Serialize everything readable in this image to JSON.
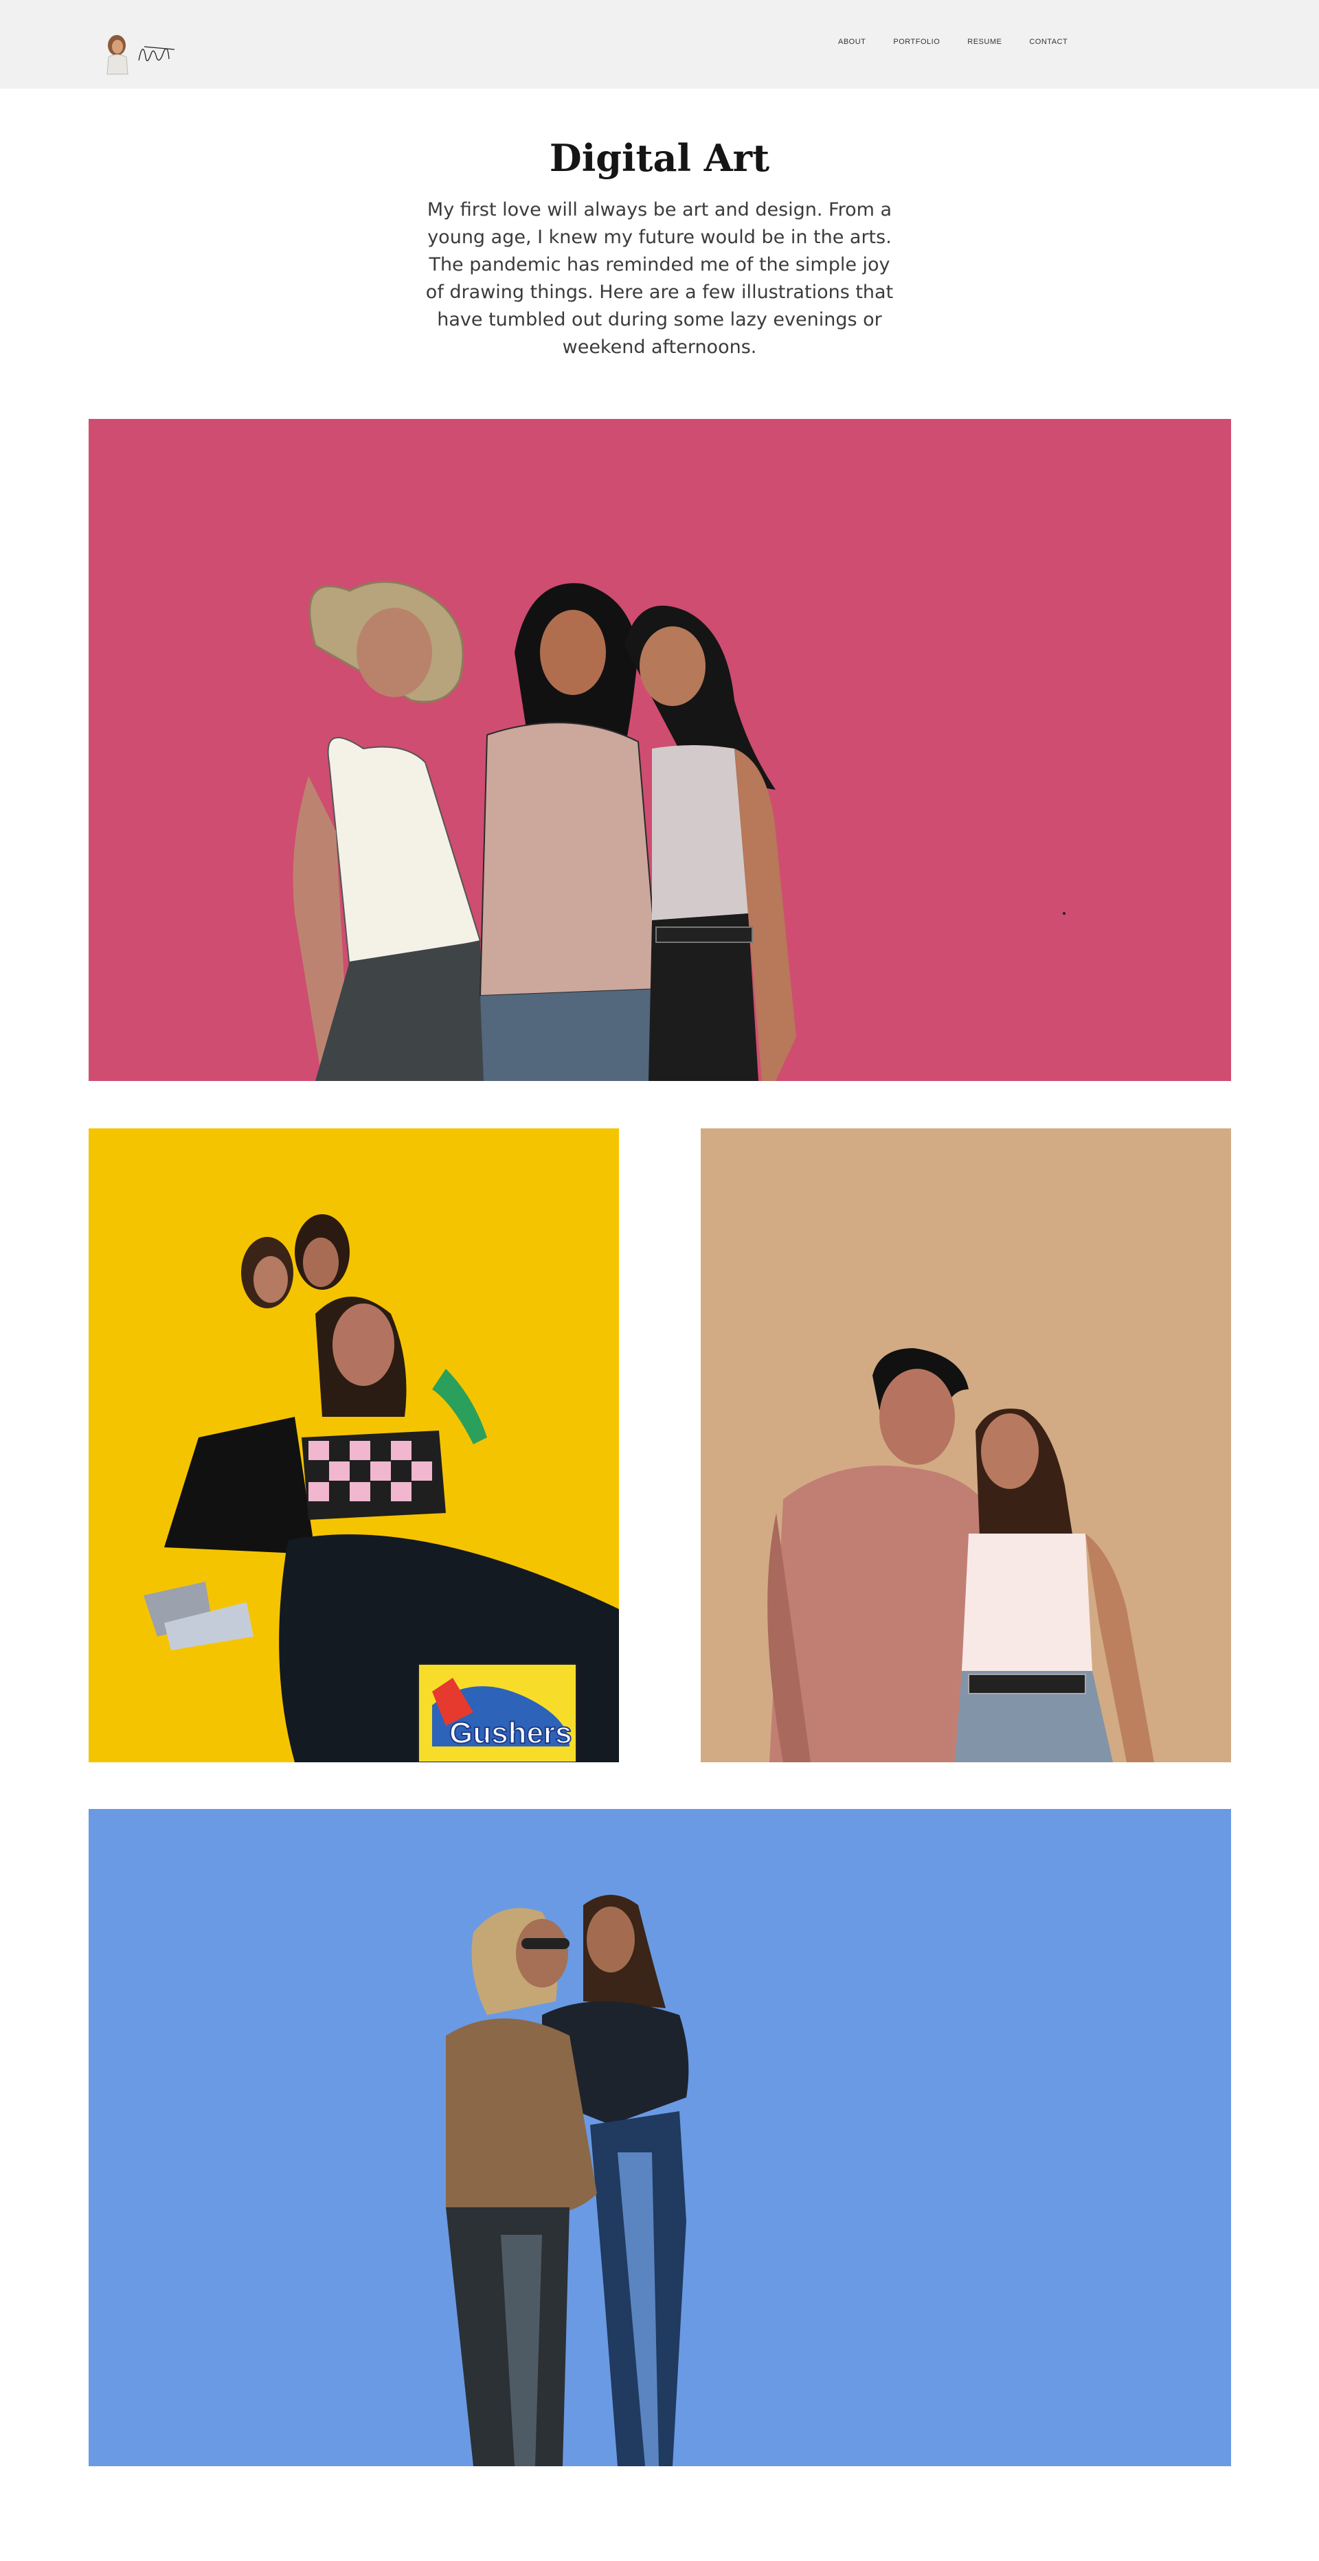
{
  "header": {
    "logo_alt": "signature logo",
    "nav": [
      {
        "label": "ABOUT"
      },
      {
        "label": "PORTFOLIO"
      },
      {
        "label": "RESUME"
      },
      {
        "label": "CONTACT"
      }
    ]
  },
  "main": {
    "title": "Digital Art",
    "intro": "My first love will always be art and design. From a young age, I knew my future would be in the arts. The pandemic has reminded me of the simple joy of drawing things. Here are a few illustrations that have tumbled out during some lazy evenings or weekend afternoons."
  },
  "artworks": [
    {
      "background": "#cf4d70",
      "subject": "three-friends-illustration"
    },
    {
      "background": "#f5c400",
      "subject": "three-girls-sitting-illustration",
      "package_text": "Gushers"
    },
    {
      "background": "#d2ab84",
      "subject": "couple-illustration"
    },
    {
      "background": "#6a9ae3",
      "subject": "two-friends-hugging-illustration"
    }
  ],
  "colors": {
    "header_bg": "#f1f1f1",
    "title": "#151515",
    "body_text": "#3b3b3b"
  }
}
